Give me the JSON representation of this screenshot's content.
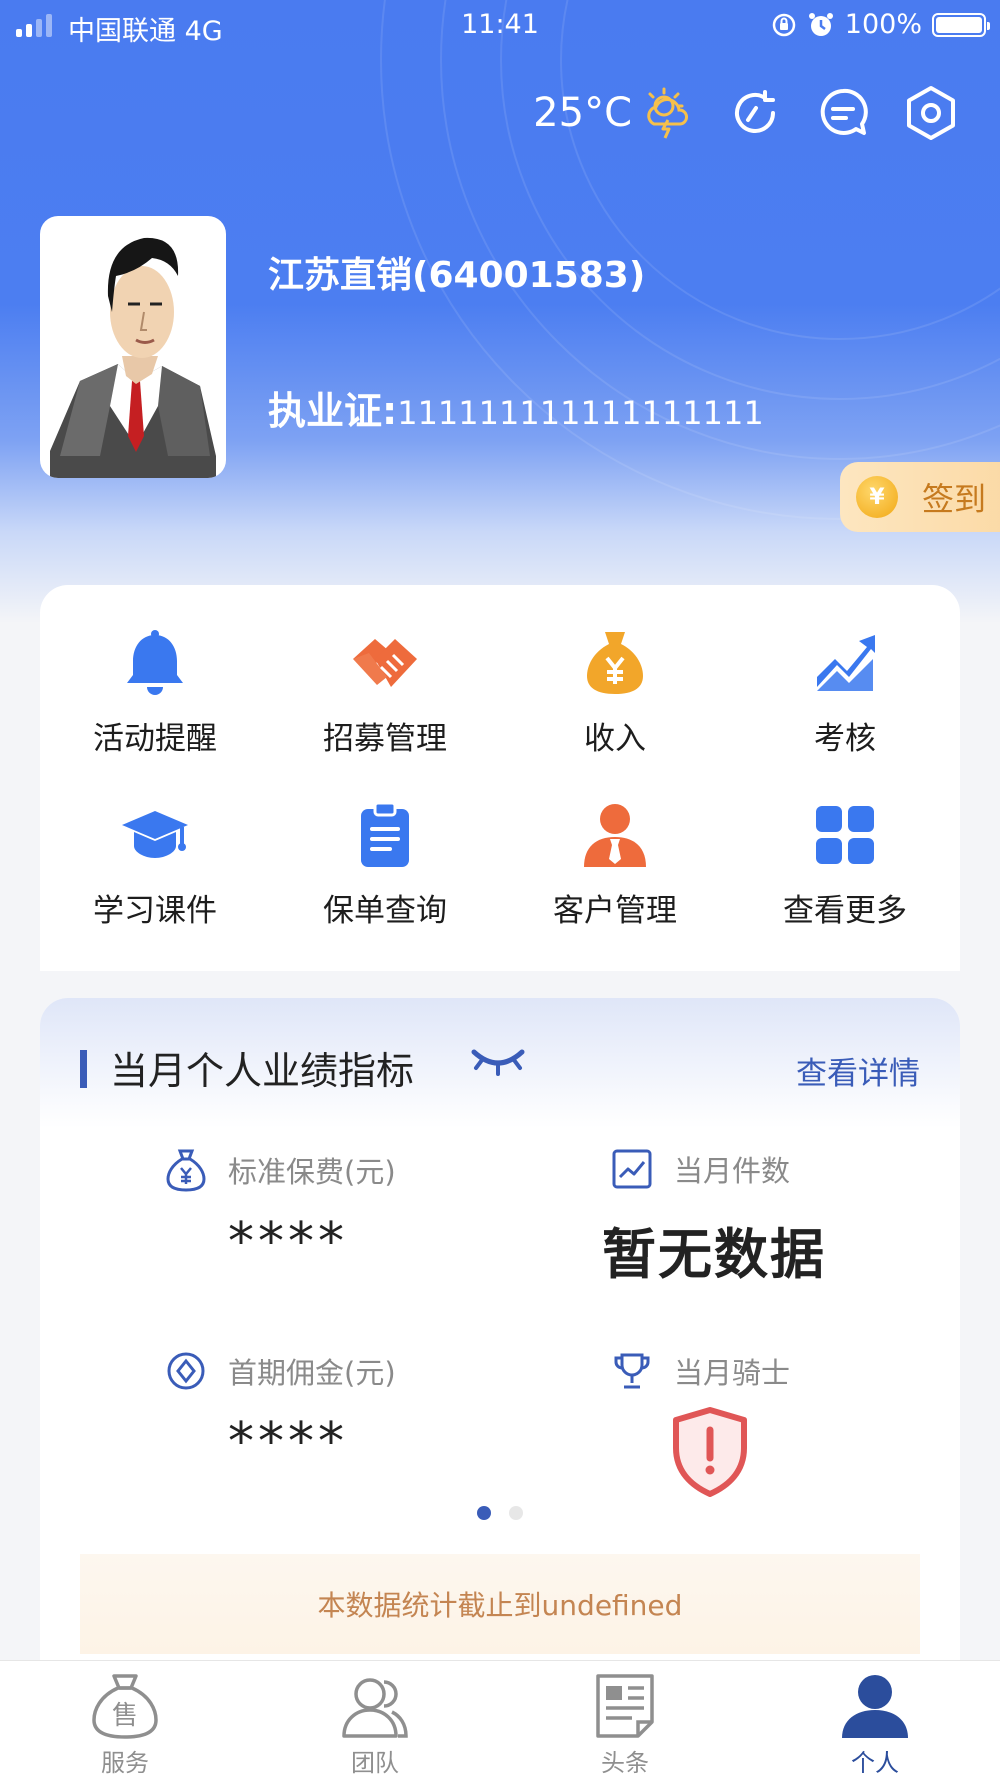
{
  "status_bar": {
    "carrier": "中国联通  4G",
    "time": "11:41",
    "battery": "100%"
  },
  "header": {
    "temperature": "25°C",
    "icons": [
      "weather-icon",
      "refresh-icon",
      "message-icon",
      "settings-icon"
    ]
  },
  "profile": {
    "org_name": "江苏直销(64001583)",
    "license_label": "执业证:",
    "license_number": "111111111111111111",
    "signin_label": "签到"
  },
  "menu": {
    "items": [
      {
        "label": "活动提醒",
        "icon": "bell-icon",
        "color": "#3a78ef"
      },
      {
        "label": "招募管理",
        "icon": "handshake-icon",
        "color": "#ee6b3c"
      },
      {
        "label": "收入",
        "icon": "money-bag-icon",
        "color": "#f2a62a"
      },
      {
        "label": "考核",
        "icon": "trend-chart-icon",
        "color": "#3a78ef"
      },
      {
        "label": "学习课件",
        "icon": "graduation-cap-icon",
        "color": "#3a78ef"
      },
      {
        "label": "保单查询",
        "icon": "clipboard-icon",
        "color": "#3a78ef"
      },
      {
        "label": "客户管理",
        "icon": "customer-icon",
        "color": "#ee6b3c"
      },
      {
        "label": "查看更多",
        "icon": "grid-icon",
        "color": "#3a78ef"
      }
    ]
  },
  "performance": {
    "title": "当月个人业绩指标",
    "detail_link": "查看详情",
    "metrics": {
      "standard_premium": {
        "label": "标准保费(元)",
        "value": "****"
      },
      "monthly_count": {
        "label": "当月件数",
        "value": "暂无数据"
      },
      "first_commission": {
        "label": "首期佣金(元)",
        "value": "****"
      },
      "monthly_knight": {
        "label": "当月骑士"
      }
    },
    "footnote": "本数据统计截止到undefined"
  },
  "tabbar": {
    "tabs": [
      {
        "label": "服务",
        "icon": "sale-bag-icon"
      },
      {
        "label": "团队",
        "icon": "team-icon"
      },
      {
        "label": "头条",
        "icon": "news-icon"
      },
      {
        "label": "个人",
        "icon": "person-icon"
      }
    ]
  },
  "colors": {
    "brand_blue": "#4a7bf0",
    "accent_navy": "#3a5cb8",
    "signin_orange": "#c67a1e"
  }
}
